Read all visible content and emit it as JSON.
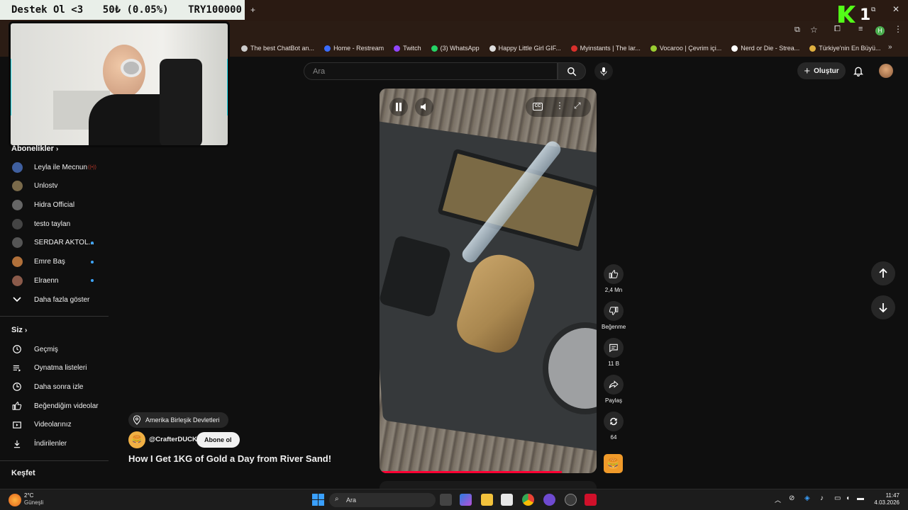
{
  "overlay": {
    "donation_left": "Destek Ol <3",
    "donation_mid": "50₺ (0.05%)",
    "donation_right": "TRY100000",
    "corner_logo": "1"
  },
  "bookmarks": [
    {
      "label": "The best ChatBot an...",
      "color": "#cccccc"
    },
    {
      "label": "Home - Restream",
      "color": "#3a6cff"
    },
    {
      "label": "Twitch",
      "color": "#9146ff"
    },
    {
      "label": "(3) WhatsApp",
      "color": "#25d366"
    },
    {
      "label": "Happy Little Girl GIF...",
      "color": "#dddddd"
    },
    {
      "label": "Myinstants | The lar...",
      "color": "#d9302c"
    },
    {
      "label": "Vocaroo | Çevrim içi...",
      "color": "#9acd32"
    },
    {
      "label": "Nerd or Die - Strea...",
      "color": "#ffffff"
    },
    {
      "label": "Türkiye'nin En Büyü...",
      "color": "#e0b040"
    }
  ],
  "header": {
    "search_placeholder": "Ara",
    "create_label": "Oluştur"
  },
  "sidebar": {
    "subscriptions_heading": "Abonelikler",
    "subscriptions": [
      {
        "label": "Leyla ile Mecnun",
        "live": true,
        "dot": false,
        "color": "#3f5f9f"
      },
      {
        "label": "Unlostv",
        "live": false,
        "dot": false,
        "color": "#7a6a4a"
      },
      {
        "label": "Hidra Official",
        "live": false,
        "dot": false,
        "color": "#666666"
      },
      {
        "label": "testo taylan",
        "live": false,
        "dot": false,
        "color": "#444444"
      },
      {
        "label": "SERDAR AKTOL...",
        "live": false,
        "dot": true,
        "color": "#555555"
      },
      {
        "label": "Emre Baş",
        "live": false,
        "dot": true,
        "color": "#b0703a"
      },
      {
        "label": "Elraenn",
        "live": false,
        "dot": true,
        "color": "#8a5a4a"
      }
    ],
    "show_more": "Daha fazla göster",
    "you_heading": "Siz",
    "you_items": [
      {
        "label": "Geçmiş",
        "icon": "history-icon"
      },
      {
        "label": "Oynatma listeleri",
        "icon": "playlists-icon"
      },
      {
        "label": "Daha sonra izle",
        "icon": "watch-later-icon"
      },
      {
        "label": "Beğendiğim videolar",
        "icon": "liked-icon"
      },
      {
        "label": "Videolarınız",
        "icon": "your-videos-icon"
      },
      {
        "label": "İndirilenler",
        "icon": "downloads-icon"
      }
    ],
    "explore_heading": "Keşfet"
  },
  "video": {
    "location": "Amerika Birleşik Devletleri",
    "channel": "@CrafterDUCK",
    "subscribe_label": "Abone ol",
    "title": "How I Get 1KG of Gold a Day from River Sand!",
    "progress": 0.84
  },
  "actions": {
    "likes": "2,4 Mn",
    "dislike_label": "Beğenme",
    "comments": "11 B",
    "share_label": "Paylaş",
    "remix_count": "64"
  },
  "taskbar": {
    "weather_temp": "2°C",
    "weather_desc": "Güneşli",
    "search_label": "Ara",
    "time": "11:47",
    "date": "4.03.2026"
  }
}
